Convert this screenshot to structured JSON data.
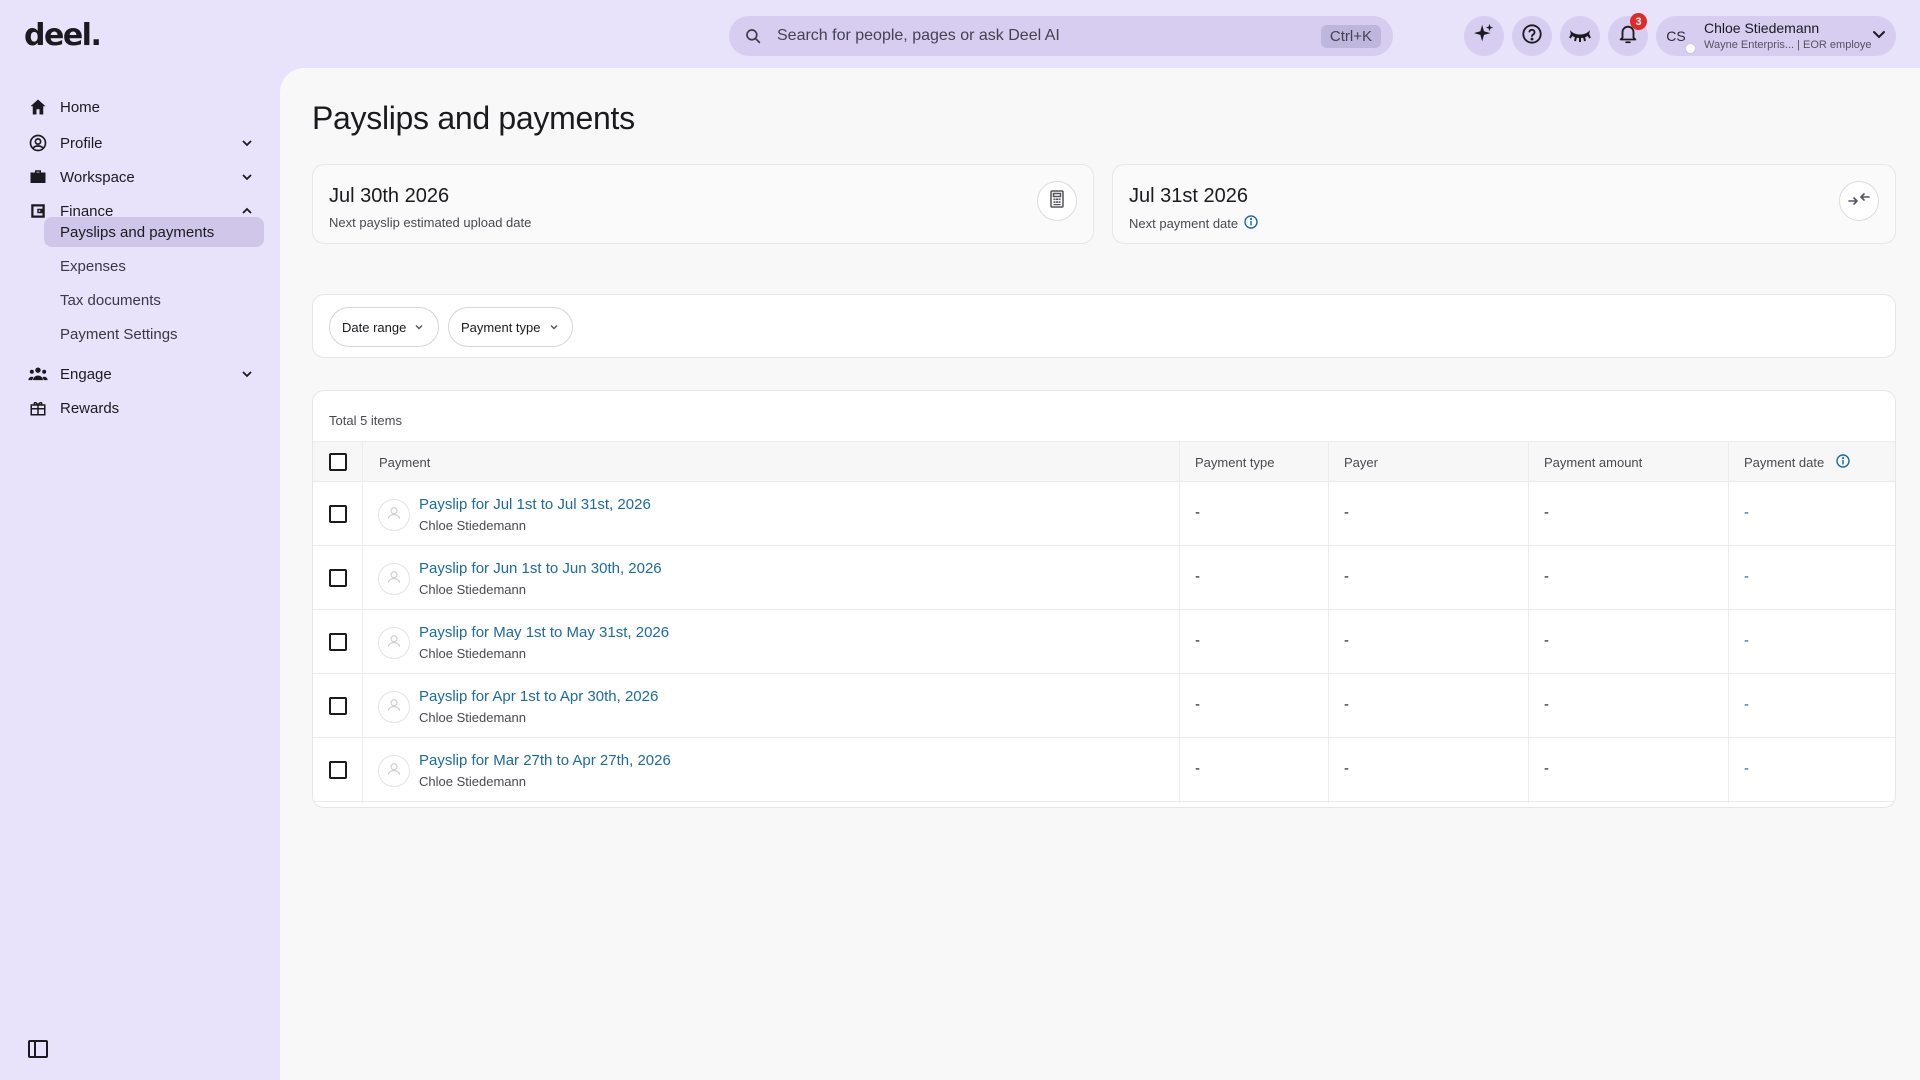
{
  "brand": {
    "logo_text": "deel."
  },
  "search": {
    "placeholder": "Search for people, pages or ask Deel AI",
    "shortcut": "Ctrl+K"
  },
  "header": {
    "notification_count": "3",
    "user": {
      "initials": "CS",
      "name": "Chloe Stiedemann",
      "subtitle": "Wayne Enterpris... | EOR employee"
    }
  },
  "sidebar": {
    "items": [
      {
        "label": "Home"
      },
      {
        "label": "Profile"
      },
      {
        "label": "Workspace"
      },
      {
        "label": "Finance"
      },
      {
        "label": "Engage"
      },
      {
        "label": "Rewards"
      }
    ],
    "finance_sub": [
      {
        "label": "Payslips and payments"
      },
      {
        "label": "Expenses"
      },
      {
        "label": "Tax documents"
      },
      {
        "label": "Payment Settings"
      }
    ]
  },
  "page": {
    "title": "Payslips and payments",
    "upcoming": [
      {
        "date": "Jul 30th 2026",
        "caption": "Next payslip estimated upload date"
      },
      {
        "date": "Jul 31st 2026",
        "caption": "Next payment date"
      }
    ],
    "filters": [
      {
        "label": "Date range"
      },
      {
        "label": "Payment type"
      }
    ],
    "table": {
      "total": "Total 5 items",
      "columns": [
        "Payment",
        "Payment type",
        "Payer",
        "Payment amount",
        "Payment date"
      ],
      "rows": [
        {
          "title": "Payslip for Jul 1st to Jul 31st, 2026",
          "person": "Chloe Stiedemann",
          "type": "-",
          "payer": "-",
          "amount": "-",
          "date": "-"
        },
        {
          "title": "Payslip for Jun 1st to Jun 30th, 2026",
          "person": "Chloe Stiedemann",
          "type": "-",
          "payer": "-",
          "amount": "-",
          "date": "-"
        },
        {
          "title": "Payslip for May 1st to May 31st, 2026",
          "person": "Chloe Stiedemann",
          "type": "-",
          "payer": "-",
          "amount": "-",
          "date": "-"
        },
        {
          "title": "Payslip for Apr 1st to Apr 30th, 2026",
          "person": "Chloe Stiedemann",
          "type": "-",
          "payer": "-",
          "amount": "-",
          "date": "-"
        },
        {
          "title": "Payslip for Mar 27th to Apr 27th, 2026",
          "person": "Chloe Stiedemann",
          "type": "-",
          "payer": "-",
          "amount": "-",
          "date": "-"
        }
      ]
    }
  },
  "colors": {
    "accent": "#e9e2fb",
    "link": "#1b6aa5",
    "badge": "#e02a2a",
    "active_nav": "#cfc6ea"
  }
}
